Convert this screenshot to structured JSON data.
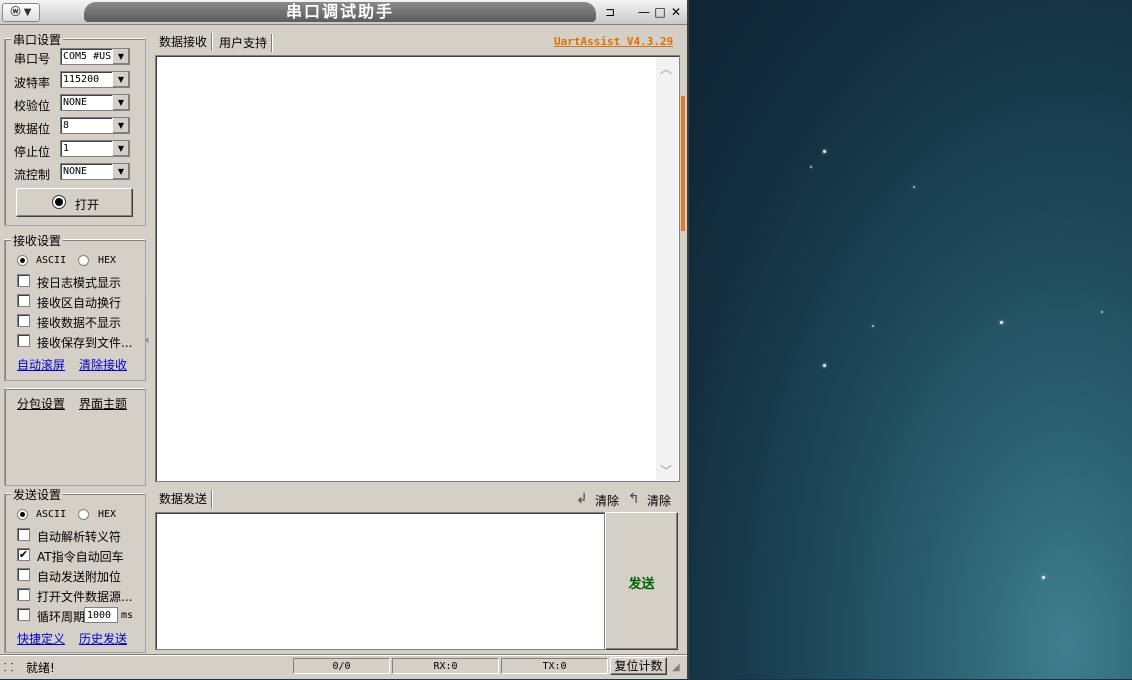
{
  "window": {
    "title": "串口调试助手",
    "sysmenu_label": "▼",
    "pin_label": "⊐",
    "min_label": "—",
    "max_label": "□",
    "close_label": "✕"
  },
  "serial_settings": {
    "legend": "串口设置",
    "fields": [
      {
        "label": "串口号",
        "value": "COM5 #US"
      },
      {
        "label": "波特率",
        "value": "115200"
      },
      {
        "label": "校验位",
        "value": "NONE"
      },
      {
        "label": "数据位",
        "value": "8"
      },
      {
        "label": "停止位",
        "value": "1"
      },
      {
        "label": "流控制",
        "value": "NONE"
      }
    ],
    "open_button": "打开"
  },
  "receive_settings": {
    "legend": "接收设置",
    "mode_ascii": "ASCII",
    "mode_hex": "HEX",
    "selected_mode": "ASCII",
    "options": [
      {
        "label": "按日志模式显示",
        "checked": false
      },
      {
        "label": "接收区自动换行",
        "checked": false
      },
      {
        "label": "接收数据不显示",
        "checked": false
      },
      {
        "label": "接收保存到文件...",
        "checked": false
      }
    ],
    "link_autoscroll": "自动滚屏",
    "link_clear": "清除接收"
  },
  "misc": {
    "packet_settings": "分包设置",
    "theme": "界面主题"
  },
  "send_settings": {
    "legend": "发送设置",
    "mode_ascii": "ASCII",
    "mode_hex": "HEX",
    "selected_mode": "ASCII",
    "options": [
      {
        "label": "自动解析转义符",
        "checked": false
      },
      {
        "label": "AT指令自动回车",
        "checked": true
      },
      {
        "label": "自动发送附加位",
        "checked": false
      },
      {
        "label": "打开文件数据源...",
        "checked": false
      }
    ],
    "cycle_label": "循环周期",
    "cycle_value": "1000",
    "cycle_unit": "ms",
    "cycle_checked": false,
    "link_shortcut": "快捷定义",
    "link_history": "历史发送"
  },
  "receive_area": {
    "tabs": [
      "数据接收",
      "用户支持"
    ],
    "brand": "UartAssist V4.3.29",
    "content": ""
  },
  "send_area": {
    "tab": "数据发送",
    "clear1": "清除",
    "clear2": "清除",
    "content": "",
    "send_button": "发送"
  },
  "status": {
    "ready": "就绪!",
    "count": "0/0",
    "rx": "RX:0",
    "tx": "TX:0",
    "reset": "复位计数"
  },
  "colors": {
    "brand": "#e07000",
    "send_button_text": "#006000",
    "link": "#0000cc"
  }
}
